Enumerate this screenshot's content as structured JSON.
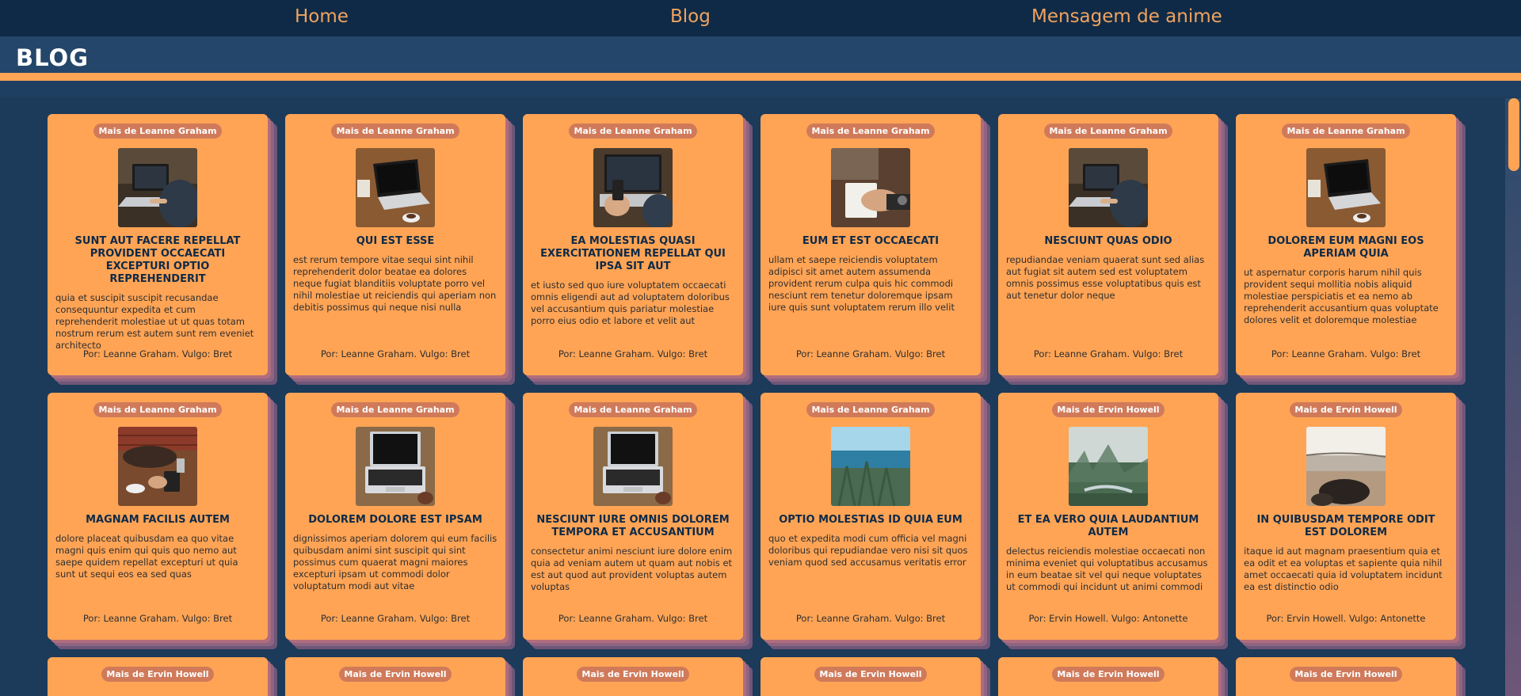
{
  "nav": {
    "items": [
      "Home",
      "Blog",
      "Mensagem de anime"
    ]
  },
  "header": {
    "title": "BLOG"
  },
  "colors": {
    "nav_bg": "#0f2a47",
    "header_bg": "#24466a",
    "accent": "#ffa455",
    "card_shadow": "#8e6483",
    "badge": "#d07a5a",
    "nav_text": "#f0a35e"
  },
  "cards": [
    {
      "badge": "Mais de Leanne Graham",
      "title": "SUNT AUT FACERE REPELLAT PROVIDENT OCCAECATI EXCEPTURI OPTIO REPREHENDERIT",
      "body": "quia et suscipit suscipit recusandae consequuntur expedita et cum reprehenderit molestiae ut ut quas totam nostrum rerum est autem sunt rem eveniet architecto",
      "byline": "Por: Leanne Graham. Vulgo: Bret",
      "image": "laptop-typing"
    },
    {
      "badge": "Mais de Leanne Graham",
      "title": "QUI EST ESSE",
      "body": "est rerum tempore vitae sequi sint nihil reprehenderit dolor beatae ea dolores neque fugiat blanditiis voluptate porro vel nihil molestiae ut reiciendis qui aperiam non debitis possimus qui neque nisi nulla",
      "byline": "Por: Leanne Graham. Vulgo: Bret",
      "image": "laptop-desk"
    },
    {
      "badge": "Mais de Leanne Graham",
      "title": "EA MOLESTIAS QUASI EXERCITATIONEM REPELLAT QUI IPSA SIT AUT",
      "body": "et iusto sed quo iure voluptatem occaecati omnis eligendi aut ad voluptatem doloribus vel accusantium quis pariatur molestiae porro eius odio et labore et velit aut",
      "byline": "Por: Leanne Graham. Vulgo: Bret",
      "image": "laptop-phone"
    },
    {
      "badge": "Mais de Leanne Graham",
      "title": "EUM ET EST OCCAECATI",
      "body": "ullam et saepe reiciendis voluptatem adipisci sit amet autem assumenda provident rerum culpa quis hic commodi nesciunt rem tenetur doloremque ipsam iure quis sunt voluptatem rerum illo velit",
      "byline": "Por: Leanne Graham. Vulgo: Bret",
      "image": "hands-writing"
    },
    {
      "badge": "Mais de Leanne Graham",
      "title": "NESCIUNT QUAS ODIO",
      "body": "repudiandae veniam quaerat sunt sed alias aut fugiat sit autem sed est voluptatem omnis possimus esse voluptatibus quis est aut tenetur dolor neque",
      "byline": "Por: Leanne Graham. Vulgo: Bret",
      "image": "laptop-typing"
    },
    {
      "badge": "Mais de Leanne Graham",
      "title": "DOLOREM EUM MAGNI EOS APERIAM QUIA",
      "body": "ut aspernatur corporis harum nihil quis provident sequi mollitia nobis aliquid molestiae perspiciatis et ea nemo ab reprehenderit accusantium quas voluptate dolores velit et doloremque molestiae",
      "byline": "Por: Leanne Graham. Vulgo: Bret",
      "image": "laptop-desk"
    },
    {
      "badge": "Mais de Leanne Graham",
      "title": "MAGNAM FACILIS AUTEM",
      "body": "dolore placeat quibusdam ea quo vitae magni quis enim qui quis quo nemo aut saepe quidem repellat excepturi ut quia sunt ut sequi eos ea sed quas",
      "byline": "Por: Leanne Graham. Vulgo: Bret",
      "image": "cafe-table"
    },
    {
      "badge": "Mais de Leanne Graham",
      "title": "DOLOREM DOLORE EST IPSAM",
      "body": "dignissimos aperiam dolorem qui eum facilis quibusdam animi sint suscipit qui sint possimus cum quaerat magni maiores excepturi ipsam ut commodi dolor voluptatum modi aut vitae",
      "byline": "Por: Leanne Graham. Vulgo: Bret",
      "image": "laptop-top"
    },
    {
      "badge": "Mais de Leanne Graham",
      "title": "NESCIUNT IURE OMNIS DOLOREM TEMPORA ET ACCUSANTIUM",
      "body": "consectetur animi nesciunt iure dolore enim quia ad veniam autem ut quam aut nobis et est aut quod aut provident voluptas autem voluptas",
      "byline": "Por: Leanne Graham. Vulgo: Bret",
      "image": "laptop-top"
    },
    {
      "badge": "Mais de Leanne Graham",
      "title": "OPTIO MOLESTIAS ID QUIA EUM",
      "body": "quo et expedita modi cum officia vel magni doloribus qui repudiandae vero nisi sit quos veniam quod sed accusamus veritatis error",
      "byline": "Por: Leanne Graham. Vulgo: Bret",
      "image": "sea-plants"
    },
    {
      "badge": "Mais de Ervin Howell",
      "title": "ET EA VERO QUIA LAUDANTIUM AUTEM",
      "body": "delectus reiciendis molestiae occaecati non minima eveniet qui voluptatibus accusamus in eum beatae sit vel qui neque voluptates ut commodi qui incidunt ut animi commodi",
      "byline": "Por: Ervin Howell. Vulgo: Antonette",
      "image": "misty-valley"
    },
    {
      "badge": "Mais de Ervin Howell",
      "title": "IN QUIBUSDAM TEMPORE ODIT EST DOLOREM",
      "body": "itaque id aut magnam praesentium quia et ea odit et ea voluptas et sapiente quia nihil amet occaecati quia id voluptatem incidunt ea est distinctio odio",
      "byline": "Por: Ervin Howell. Vulgo: Antonette",
      "image": "beach-rocks"
    }
  ],
  "partial_row": [
    "Mais de Ervin Howell",
    "Mais de Ervin Howell",
    "Mais de Ervin Howell",
    "Mais de Ervin Howell",
    "Mais de Ervin Howell",
    "Mais de Ervin Howell"
  ]
}
